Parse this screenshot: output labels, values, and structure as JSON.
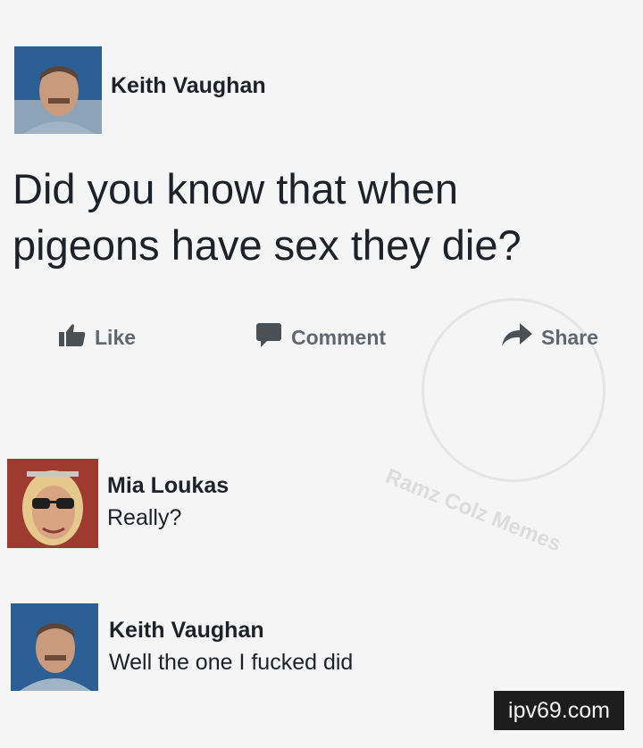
{
  "post": {
    "author": "Keith Vaughan",
    "text_line1": "Did you know that when",
    "text_line2": "pigeons have sex they die?"
  },
  "actions": {
    "like": "Like",
    "comment": "Comment",
    "share": "Share"
  },
  "comments": [
    {
      "author": "Mia Loukas",
      "text": "Really?"
    },
    {
      "author": "Keith Vaughan",
      "text": "Well the one I fucked did"
    }
  ],
  "watermark": {
    "text": "Ramz Colz Memes"
  },
  "site_badge": "ipv69.com",
  "colors": {
    "background": "#f4f5f4",
    "action_gray": "#616770",
    "name_text": "#1d2129"
  }
}
